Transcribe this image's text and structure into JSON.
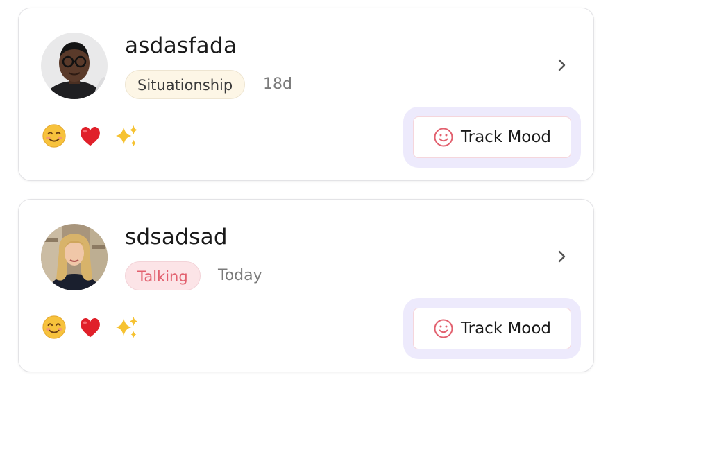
{
  "contacts": [
    {
      "name": "asdasfada",
      "tag": "Situationship",
      "tag_style": "situationship",
      "time": "18d",
      "avatar": "man-portrait",
      "emojis": [
        "smiling-face-icon",
        "red-heart-icon",
        "sparkles-icon"
      ],
      "action_label": "Track Mood"
    },
    {
      "name": "sdsadsad",
      "tag": "Talking",
      "tag_style": "talking",
      "time": "Today",
      "avatar": "woman-portrait",
      "emojis": [
        "smiling-face-icon",
        "red-heart-icon",
        "sparkles-icon"
      ],
      "action_label": "Track Mood"
    }
  ],
  "colors": {
    "accent_pink": "#e2606e",
    "track_wrap_bg": "#edeafc",
    "situationship_bg": "#fdf6e6",
    "talking_bg": "#fce4e7"
  }
}
